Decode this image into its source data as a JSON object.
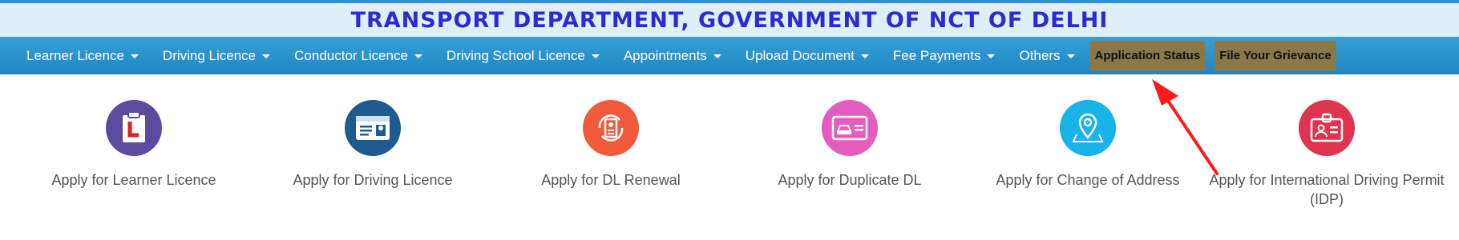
{
  "header": {
    "title": "TRANSPORT DEPARTMENT, GOVERNMENT OF NCT OF DELHI"
  },
  "nav": {
    "items": [
      {
        "label": "Learner Licence"
      },
      {
        "label": "Driving Licence"
      },
      {
        "label": "Conductor Licence"
      },
      {
        "label": "Driving School Licence"
      },
      {
        "label": "Appointments"
      },
      {
        "label": "Upload Document"
      },
      {
        "label": "Fee Payments"
      },
      {
        "label": "Others"
      }
    ],
    "buttons": [
      {
        "label": "Application Status"
      },
      {
        "label": "File Your Grievance"
      }
    ]
  },
  "services": [
    {
      "label": "Apply for Learner Licence",
      "icon": "learner-licence-icon",
      "color": "#5b4a9e"
    },
    {
      "label": "Apply for Driving Licence",
      "icon": "driving-licence-icon",
      "color": "#1e5c8f"
    },
    {
      "label": "Apply for DL Renewal",
      "icon": "dl-renewal-icon",
      "color": "#f05a3b"
    },
    {
      "label": "Apply for Duplicate DL",
      "icon": "duplicate-dl-icon",
      "color": "#e55cbf"
    },
    {
      "label": "Apply for Change of Address",
      "icon": "location-icon",
      "color": "#18b3e8"
    },
    {
      "label": "Apply for International Driving Permit (IDP)",
      "icon": "idp-icon",
      "color": "#e03350"
    }
  ],
  "colors": {
    "header_bg": "#dfeff8",
    "header_text": "#2a2ad6",
    "nav_bg": "#2a93cc",
    "nav_button_bg": "#8b7747",
    "annotation_arrow": "#ff1a1a"
  }
}
